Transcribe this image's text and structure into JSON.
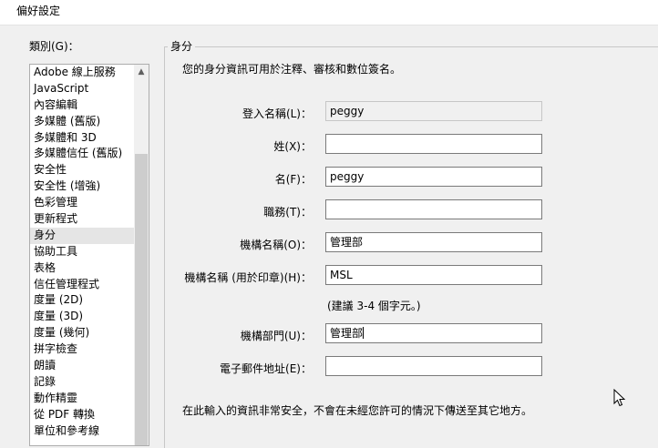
{
  "window": {
    "title": "偏好設定"
  },
  "category": {
    "label": "類別(G)：",
    "items": [
      "Adobe 線上服務",
      "JavaScript",
      "內容編輯",
      "多媒體 (舊版)",
      "多媒體和 3D",
      "多媒體信任 (舊版)",
      "安全性",
      "安全性 (增強)",
      "色彩管理",
      "更新程式",
      "身分",
      "協助工具",
      "表格",
      "信任管理程式",
      "度量 (2D)",
      "度量 (3D)",
      "度量 (幾何)",
      "拼字檢查",
      "朗讀",
      "記錄",
      "動作精靈",
      "從 PDF 轉換",
      "單位和參考線"
    ],
    "selected_index": 10
  },
  "identity": {
    "group_title": "身分",
    "intro": "您的身分資訊可用於注釋、審核和數位簽名。",
    "fields": [
      {
        "label": "登入名稱(L)：",
        "value": "peggy"
      },
      {
        "label": "姓(X)：",
        "value": ""
      },
      {
        "label": "名(F)：",
        "value": "peggy"
      },
      {
        "label": "職務(T)：",
        "value": ""
      },
      {
        "label": "機構名稱(O)：",
        "value": "管理部"
      },
      {
        "label": "機構名稱 (用於印章)(H)：",
        "value": "MSL"
      },
      {
        "label": "機構部門(U)：",
        "value": "管理部"
      },
      {
        "label": "電子郵件地址(E)：",
        "value": ""
      }
    ],
    "stamp_hint": "(建議 3-4 個字元。)",
    "footer": "在此輸入的資訊非常安全，不會在未經您許可的情況下傳送至其它地方。"
  },
  "icons": {
    "scroll_up": "scroll-up-arrow-icon",
    "cursor": "mouse-cursor-icon"
  }
}
